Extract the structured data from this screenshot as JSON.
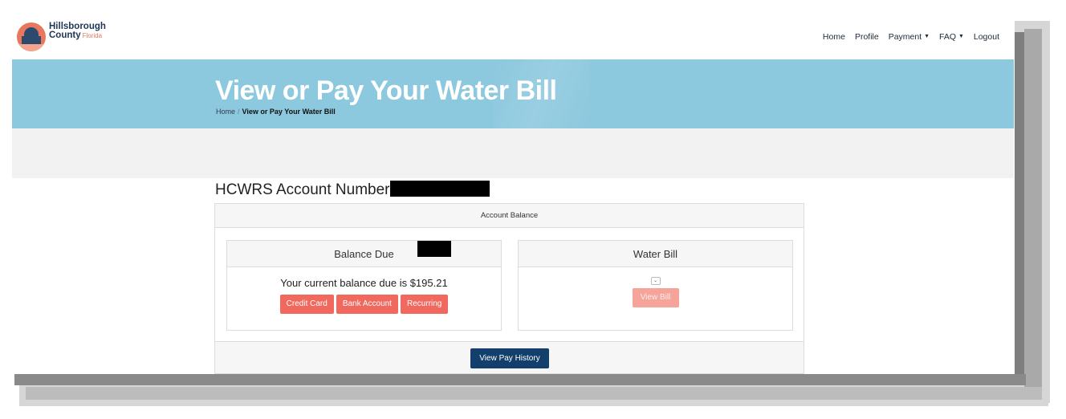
{
  "brand": {
    "line1": "Hillsborough",
    "line2": "County",
    "line2_suffix": "Florida",
    "seal_icon": "county-seal-icon"
  },
  "nav": {
    "home": "Home",
    "profile": "Profile",
    "payment": "Payment",
    "faq": "FAQ",
    "logout": "Logout"
  },
  "hero": {
    "title": "View or Pay Your Water Bill",
    "breadcrumb_home": "Home",
    "breadcrumb_sep": "/",
    "breadcrumb_current": "View or Pay Your Water Bill"
  },
  "account": {
    "label": "HCWRS Account Number:"
  },
  "card": {
    "header": "Account Balance",
    "balance": {
      "title": "Balance Due",
      "text": "Your current balance due is $195.21",
      "buttons": [
        "Credit Card",
        "Bank Account",
        "Recurring"
      ]
    },
    "water_bill": {
      "title": "Water Bill",
      "view_bill": "View Bill"
    },
    "footer_button": "View Pay History"
  },
  "colors": {
    "hero_bg": "#8cc8de",
    "primary_btn": "#f0685e",
    "disabled_btn": "#f6a39a",
    "history_btn": "#123f6b"
  }
}
